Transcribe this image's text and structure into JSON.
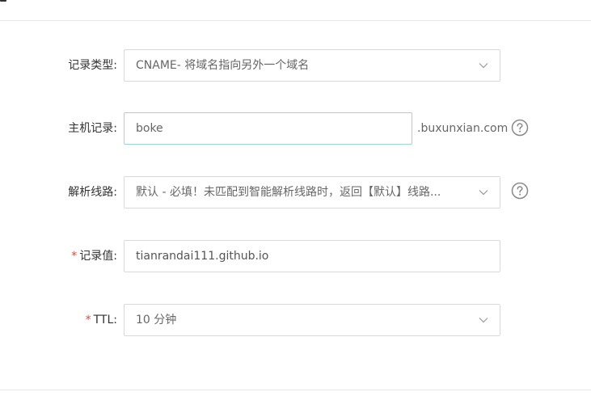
{
  "form": {
    "record_type": {
      "label": "记录类型:",
      "value": "CNAME- 将域名指向另外一个域名",
      "icon": "chevron-down-icon"
    },
    "host": {
      "label": "主机记录:",
      "value": "boke",
      "suffix": ".buxunxian.com",
      "icon": "question-circle-icon"
    },
    "line": {
      "label": "解析线路:",
      "value": "默认 - 必填！未匹配到智能解析线路时，返回【默认】线路...",
      "icon": "question-circle-icon"
    },
    "record_value": {
      "required_mark": "*",
      "label": "记录值:",
      "value": "tianrandai111.github.io"
    },
    "ttl": {
      "required_mark": "*",
      "label": "TTL:",
      "value": "10 分钟"
    }
  },
  "colors": {
    "border": "#d9d9d9",
    "focused_border": "#9ed4dc",
    "required": "#f04134",
    "text": "#333333",
    "value_text": "#666666"
  }
}
